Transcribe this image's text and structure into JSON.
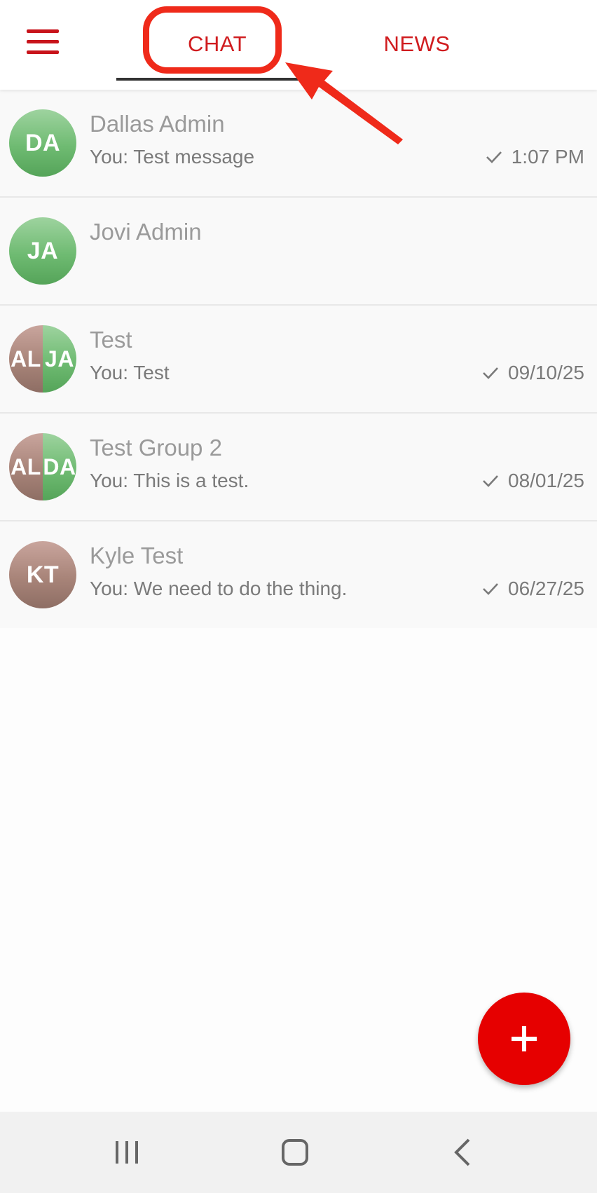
{
  "header": {
    "menu_icon": "hamburger-menu-icon",
    "tabs": [
      {
        "label": "CHAT",
        "selected": true
      },
      {
        "label": "NEWS",
        "selected": false
      }
    ]
  },
  "chats": [
    {
      "initials": "DA",
      "name": "Dallas Admin",
      "preview": "You: Test message",
      "time": "1:07 PM",
      "sent_check": true,
      "avatar_colors": [
        "green"
      ]
    },
    {
      "initials": "JA",
      "name": "Jovi Admin",
      "preview": "",
      "time": "",
      "sent_check": false,
      "avatar_colors": [
        "green"
      ]
    },
    {
      "initials_left": "AL",
      "initials_right": "JA",
      "name": "Test",
      "preview": "You: Test",
      "time": "09/10/25",
      "sent_check": true,
      "avatar_colors": [
        "brown",
        "green"
      ]
    },
    {
      "initials_left": "AL",
      "initials_right": "DA",
      "name": "Test Group 2",
      "preview": "You: This is a test.",
      "time": "08/01/25",
      "sent_check": true,
      "avatar_colors": [
        "brown",
        "green"
      ]
    },
    {
      "initials": "KT",
      "name": "Kyle Test",
      "preview": "You: We need to do the thing.",
      "time": "06/27/25",
      "sent_check": true,
      "avatar_colors": [
        "brown"
      ]
    }
  ],
  "fab": {
    "icon": "plus-icon"
  },
  "system_nav": {
    "recent_icon": "recent-apps-icon",
    "home_icon": "home-icon",
    "back_icon": "back-icon"
  },
  "colors": {
    "accent": "#d01c1f",
    "fab": "#e60000",
    "annotation": "#ef2a1a",
    "avatar_green": "#6fbb72",
    "avatar_brown": "#a88479"
  }
}
